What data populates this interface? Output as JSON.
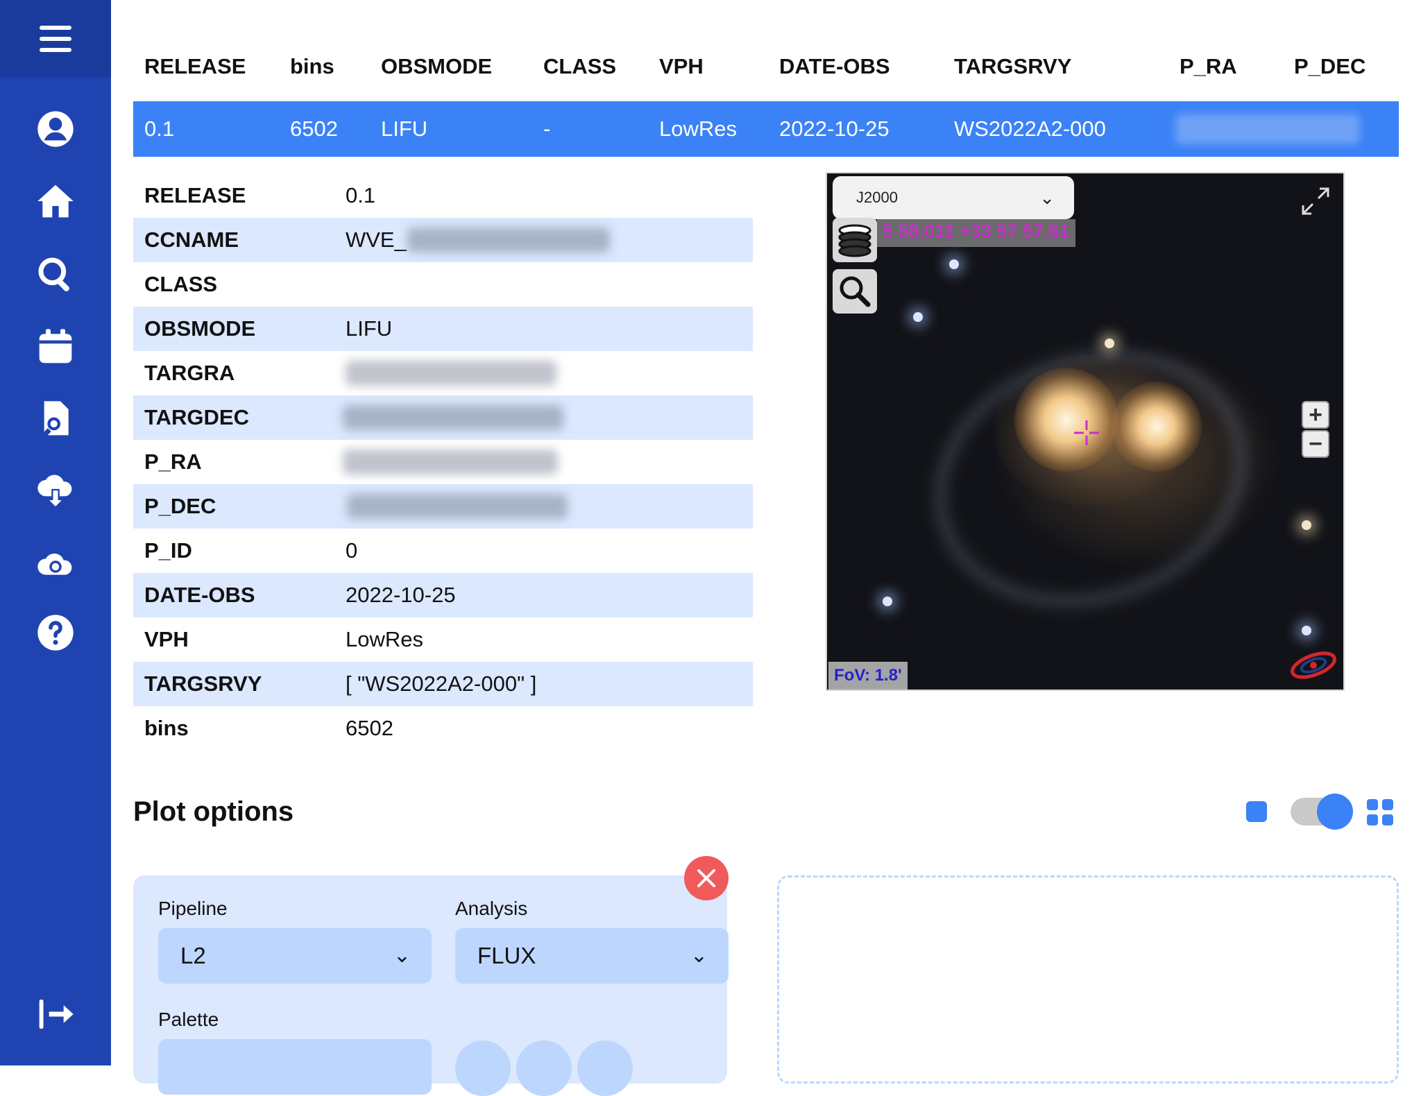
{
  "sidebar": {
    "items": [
      {
        "icon": "menu-icon"
      },
      {
        "icon": "user-icon"
      },
      {
        "icon": "home-icon"
      },
      {
        "icon": "search-icon"
      },
      {
        "icon": "calendar-icon"
      },
      {
        "icon": "document-search-icon"
      },
      {
        "icon": "cloud-download-icon"
      },
      {
        "icon": "cloud-sync-icon"
      },
      {
        "icon": "help-icon"
      },
      {
        "icon": "logout-icon"
      }
    ]
  },
  "results_table": {
    "headers": [
      "RELEASE",
      "bins",
      "OBSMODE",
      "CLASS",
      "VPH",
      "DATE-OBS",
      "TARGSRVY",
      "P_RA",
      "P_DEC"
    ],
    "row": [
      "0.1",
      "6502",
      "LIFU",
      "-",
      "LowRes",
      "2022-10-25",
      "WS2022A2-000",
      "",
      ""
    ]
  },
  "details": {
    "rows": [
      {
        "key": "RELEASE",
        "value": "0.1"
      },
      {
        "key": "CCNAME",
        "value": "WVE_"
      },
      {
        "key": "CLASS",
        "value": ""
      },
      {
        "key": "OBSMODE",
        "value": "LIFU"
      },
      {
        "key": "TARGRA",
        "value": ""
      },
      {
        "key": "TARGDEC",
        "value": ""
      },
      {
        "key": "P_RA",
        "value": ""
      },
      {
        "key": "P_DEC",
        "value": ""
      },
      {
        "key": "P_ID",
        "value": "0"
      },
      {
        "key": "DATE-OBS",
        "value": "2022-10-25"
      },
      {
        "key": "VPH",
        "value": "LowRes"
      },
      {
        "key": "TARGSRVY",
        "value": "[ \"WS2022A2-000\" ]"
      },
      {
        "key": "bins",
        "value": "6502"
      }
    ]
  },
  "viewer": {
    "frame": "J2000",
    "coordinates": "5 58.011 +33 57 57.61",
    "fov": "FoV: 1.8'",
    "zoom_in": "+",
    "zoom_out": "−"
  },
  "plot_options": {
    "title": "Plot options",
    "pipeline_label": "Pipeline",
    "pipeline_value": "L2",
    "analysis_label": "Analysis",
    "analysis_value": "FLUX",
    "palette_label": "Palette",
    "layout_toggle_on": true
  },
  "colors": {
    "sidebar": "#1f44b2",
    "accent": "#3b82f6",
    "row_alt": "#dbe8fe",
    "close": "#f05a5a"
  }
}
